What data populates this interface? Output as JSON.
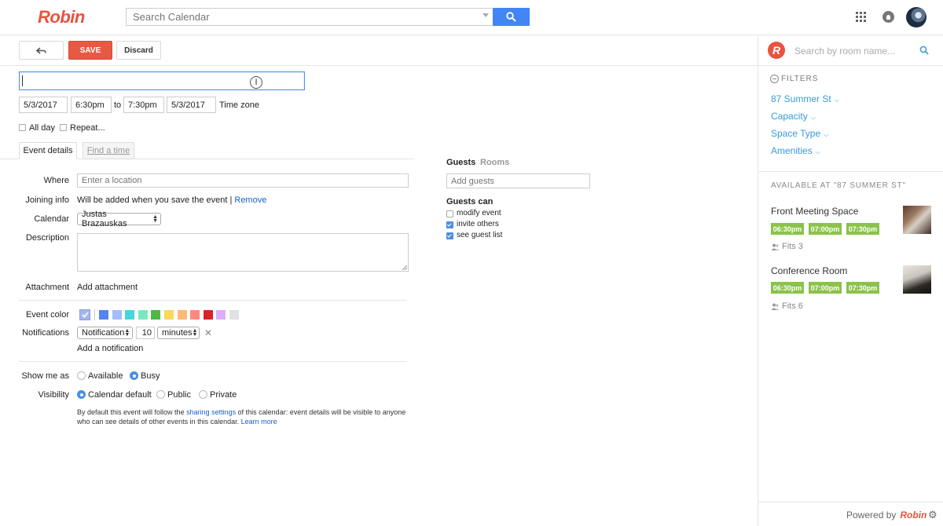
{
  "app": {
    "logo": "Robin"
  },
  "search": {
    "placeholder": "Search Calendar"
  },
  "toolbar": {
    "save_label": "SAVE",
    "discard_label": "Discard"
  },
  "event": {
    "start_date": "5/3/2017",
    "start_time": "6:30pm",
    "to_label": "to",
    "end_time": "7:30pm",
    "end_date": "5/3/2017",
    "timezone_label": "Time zone",
    "all_day_label": "All day",
    "repeat_label": "Repeat..."
  },
  "tabs": {
    "details": "Event details",
    "find_time": "Find a time"
  },
  "details": {
    "where_label": "Where",
    "where_placeholder": "Enter a location",
    "joining_label": "Joining info",
    "joining_text": "Will be added when you save the event |",
    "joining_remove": "Remove",
    "calendar_label": "Calendar",
    "calendar_value": "Justas Brazauskas",
    "description_label": "Description",
    "attachment_label": "Attachment",
    "attachment_link": "Add attachment",
    "color_label": "Event color",
    "colors": [
      "#5484ed",
      "#a4bdfc",
      "#46d6db",
      "#7ae7bf",
      "#51b749",
      "#fbd75b",
      "#ffb878",
      "#ff887c",
      "#dc2127",
      "#dbadff",
      "#e1e1e1"
    ],
    "notifications_label": "Notifications",
    "notification_type": "Notification",
    "notification_amount": "10",
    "notification_unit": "minutes",
    "add_notification": "Add a notification",
    "show_me_as_label": "Show me as",
    "available_label": "Available",
    "busy_label": "Busy",
    "visibility_label": "Visibility",
    "calendar_default_label": "Calendar default",
    "public_label": "Public",
    "private_label": "Private",
    "note_part1": "By default this event will follow the",
    "note_link1": "sharing settings",
    "note_part2": "of this calendar: event details will be visible to anyone",
    "note_part3": "who can see details of other events in this calendar.",
    "note_link2": "Learn more"
  },
  "guests": {
    "tab_guests": "Guests",
    "tab_rooms": "Rooms",
    "add_placeholder": "Add guests",
    "can_label": "Guests can",
    "modify": "modify event",
    "invite": "invite others",
    "see_list": "see guest list"
  },
  "robin": {
    "logo_letter": "R",
    "search_placeholder": "Search by room name...",
    "filters_label": "FILTERS",
    "filters": [
      "87 Summer St",
      "Capacity",
      "Space Type",
      "Amenities"
    ],
    "available_heading": "AVAILABLE AT \"87 SUMMER ST\"",
    "rooms": [
      {
        "name": "Front Meeting Space",
        "slots": [
          "06:30pm",
          "07:00pm",
          "07:30pm"
        ],
        "fits": "Fits 3"
      },
      {
        "name": "Conference Room",
        "slots": [
          "06:30pm",
          "07:00pm",
          "07:30pm"
        ],
        "fits": "Fits 6"
      }
    ],
    "powered_by": "Powered by",
    "powered_brand": "Robin"
  }
}
